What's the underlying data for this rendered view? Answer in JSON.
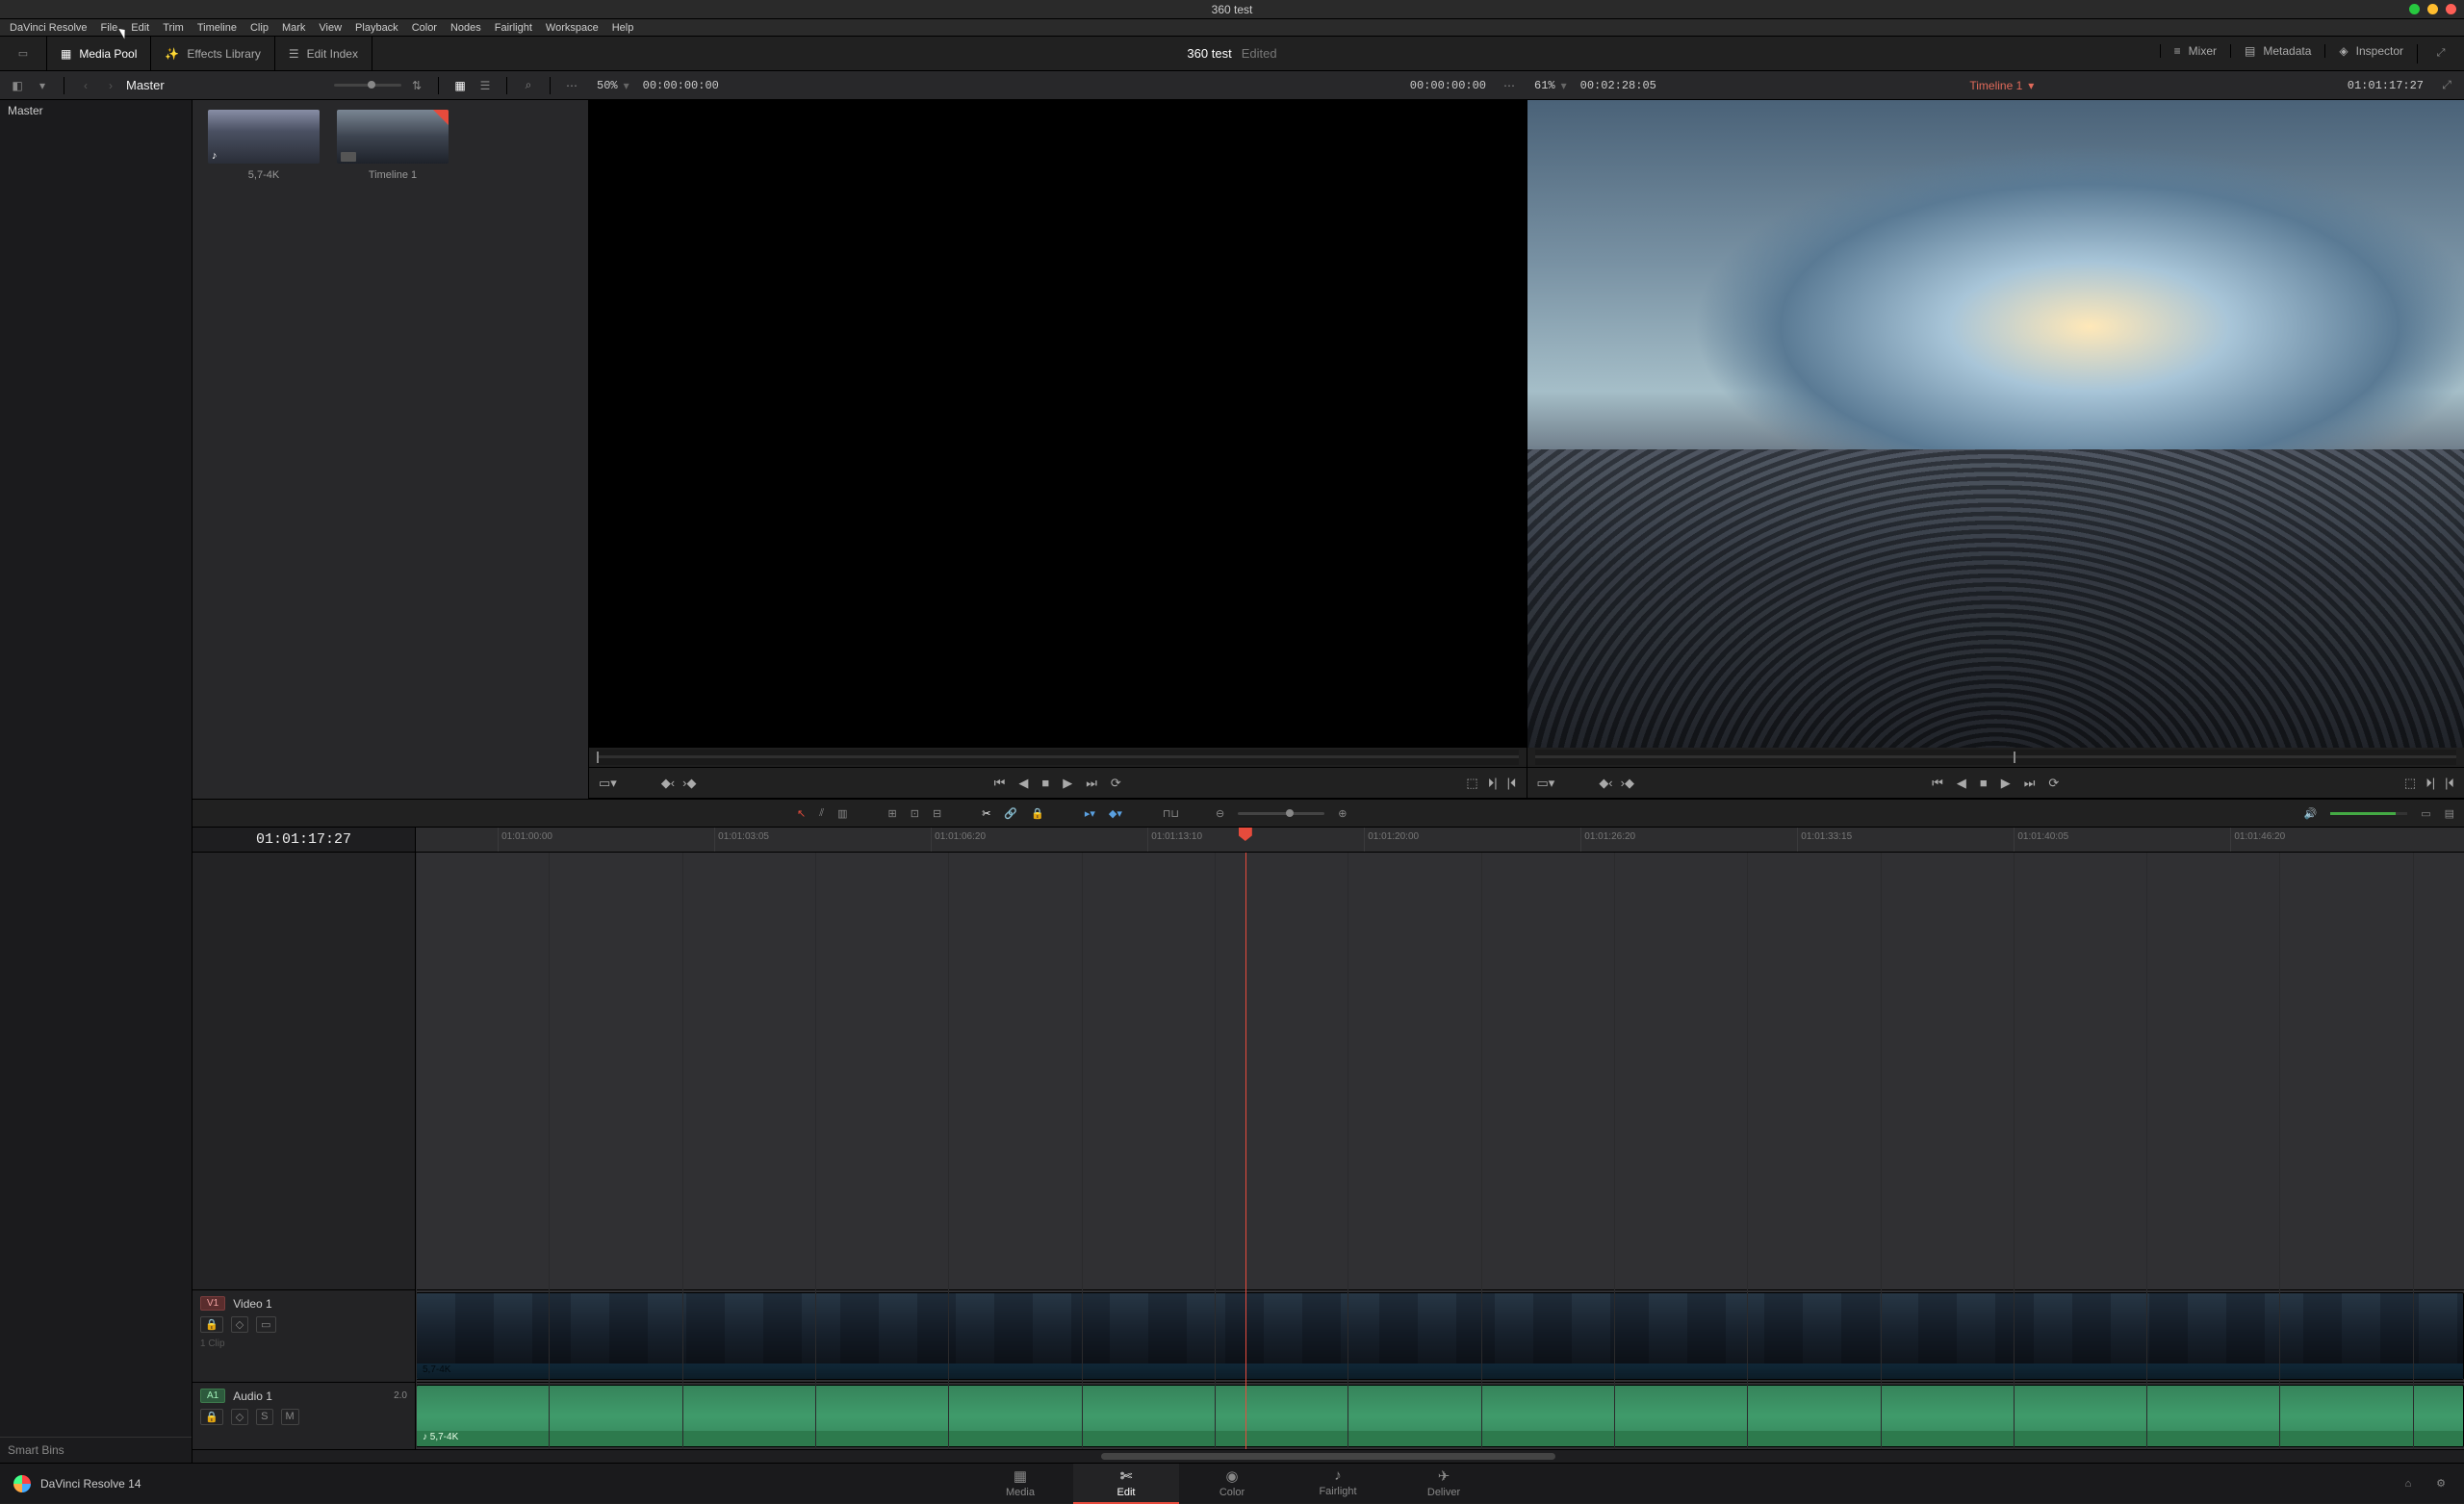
{
  "titlebar": {
    "title": "360 test"
  },
  "menubar": [
    "DaVinci Resolve",
    "File",
    "Edit",
    "Trim",
    "Timeline",
    "Clip",
    "Mark",
    "View",
    "Playback",
    "Color",
    "Nodes",
    "Fairlight",
    "Workspace",
    "Help"
  ],
  "toptoolbar": {
    "media_pool": "Media Pool",
    "effects_library": "Effects Library",
    "edit_index": "Edit Index",
    "project_name": "360 test",
    "project_status": "Edited",
    "mixer": "Mixer",
    "metadata": "Metadata",
    "inspector": "Inspector"
  },
  "pool_header": {
    "breadcrumb": "Master",
    "bin_root": "Master",
    "smart_bins": "Smart Bins"
  },
  "clips": [
    {
      "name": "5,7-4K",
      "kind": "audio"
    },
    {
      "name": "Timeline 1",
      "kind": "timeline"
    }
  ],
  "source_viewer": {
    "zoom": "50%",
    "tc_left": "00:00:00:00",
    "tc_right": "00:00:00:00"
  },
  "program_viewer": {
    "zoom": "61%",
    "duration": "00:02:28:05",
    "timeline_name": "Timeline 1",
    "tc_right": "01:01:17:27"
  },
  "timeline": {
    "current_tc": "01:01:17:27",
    "ruler_marks": [
      "01:01:00:00",
      "01:01:03:05",
      "01:01:06:20",
      "01:01:13:10",
      "01:01:20:00",
      "01:01:26:20",
      "01:01:33:15",
      "01:01:40:05",
      "01:01:46:20"
    ],
    "tracks": {
      "video": {
        "tag": "V1",
        "name": "Video 1",
        "clip_name": "5,7-4K",
        "clip_meta": "1 Clip"
      },
      "audio": {
        "tag": "A1",
        "name": "Audio 1",
        "level": "2.0",
        "clip_name": "5,7-4K",
        "btn_s": "S",
        "btn_m": "M"
      }
    }
  },
  "pages": {
    "media": "Media",
    "edit": "Edit",
    "color": "Color",
    "fairlight": "Fairlight",
    "deliver": "Deliver"
  },
  "footer": {
    "app": "DaVinci Resolve 14"
  }
}
